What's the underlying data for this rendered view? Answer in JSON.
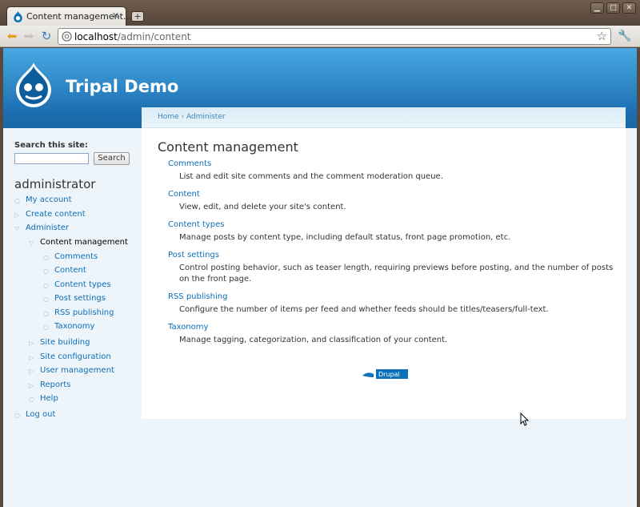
{
  "browser": {
    "tab_title": "Content management...",
    "tab_close": "✕",
    "new_tab": "+",
    "url_host": "localhost",
    "url_path": "/admin/content",
    "window_buttons": [
      "▁",
      "□",
      "✕"
    ]
  },
  "site": {
    "name": "Tripal Demo"
  },
  "breadcrumb": {
    "home": "Home",
    "separator": "›",
    "administer": "Administer"
  },
  "page": {
    "title": "Content management",
    "items": [
      {
        "label": "Comments",
        "desc": "List and edit site comments and the comment moderation queue."
      },
      {
        "label": "Content",
        "desc": "View, edit, and delete your site's content."
      },
      {
        "label": "Content types",
        "desc": "Manage posts by content type, including default status, front page promotion, etc."
      },
      {
        "label": "Post settings",
        "desc": "Control posting behavior, such as teaser length, requiring previews before posting, and the number of posts on the front page."
      },
      {
        "label": "RSS publishing",
        "desc": "Configure the number of items per feed and whether feeds should be titles/teasers/full-text."
      },
      {
        "label": "Taxonomy",
        "desc": "Manage tagging, categorization, and classification of your content."
      }
    ],
    "powered_by": "Drupal"
  },
  "sidebar": {
    "search_label": "Search this site:",
    "search_value": "",
    "search_button": "Search",
    "user_heading": "administrator",
    "menu": [
      "My account",
      "Create content",
      "Administer",
      "Content management",
      "Comments",
      "Content",
      "Content types",
      "Post settings",
      "RSS publishing",
      "Taxonomy",
      "Site building",
      "Site configuration",
      "User management",
      "Reports",
      "Help",
      "Log out"
    ]
  },
  "colors": {
    "link": "#0d6eb8",
    "header_top": "#48a9e4",
    "header_bottom": "#1a65a5",
    "page_bg": "#edf5fa"
  }
}
